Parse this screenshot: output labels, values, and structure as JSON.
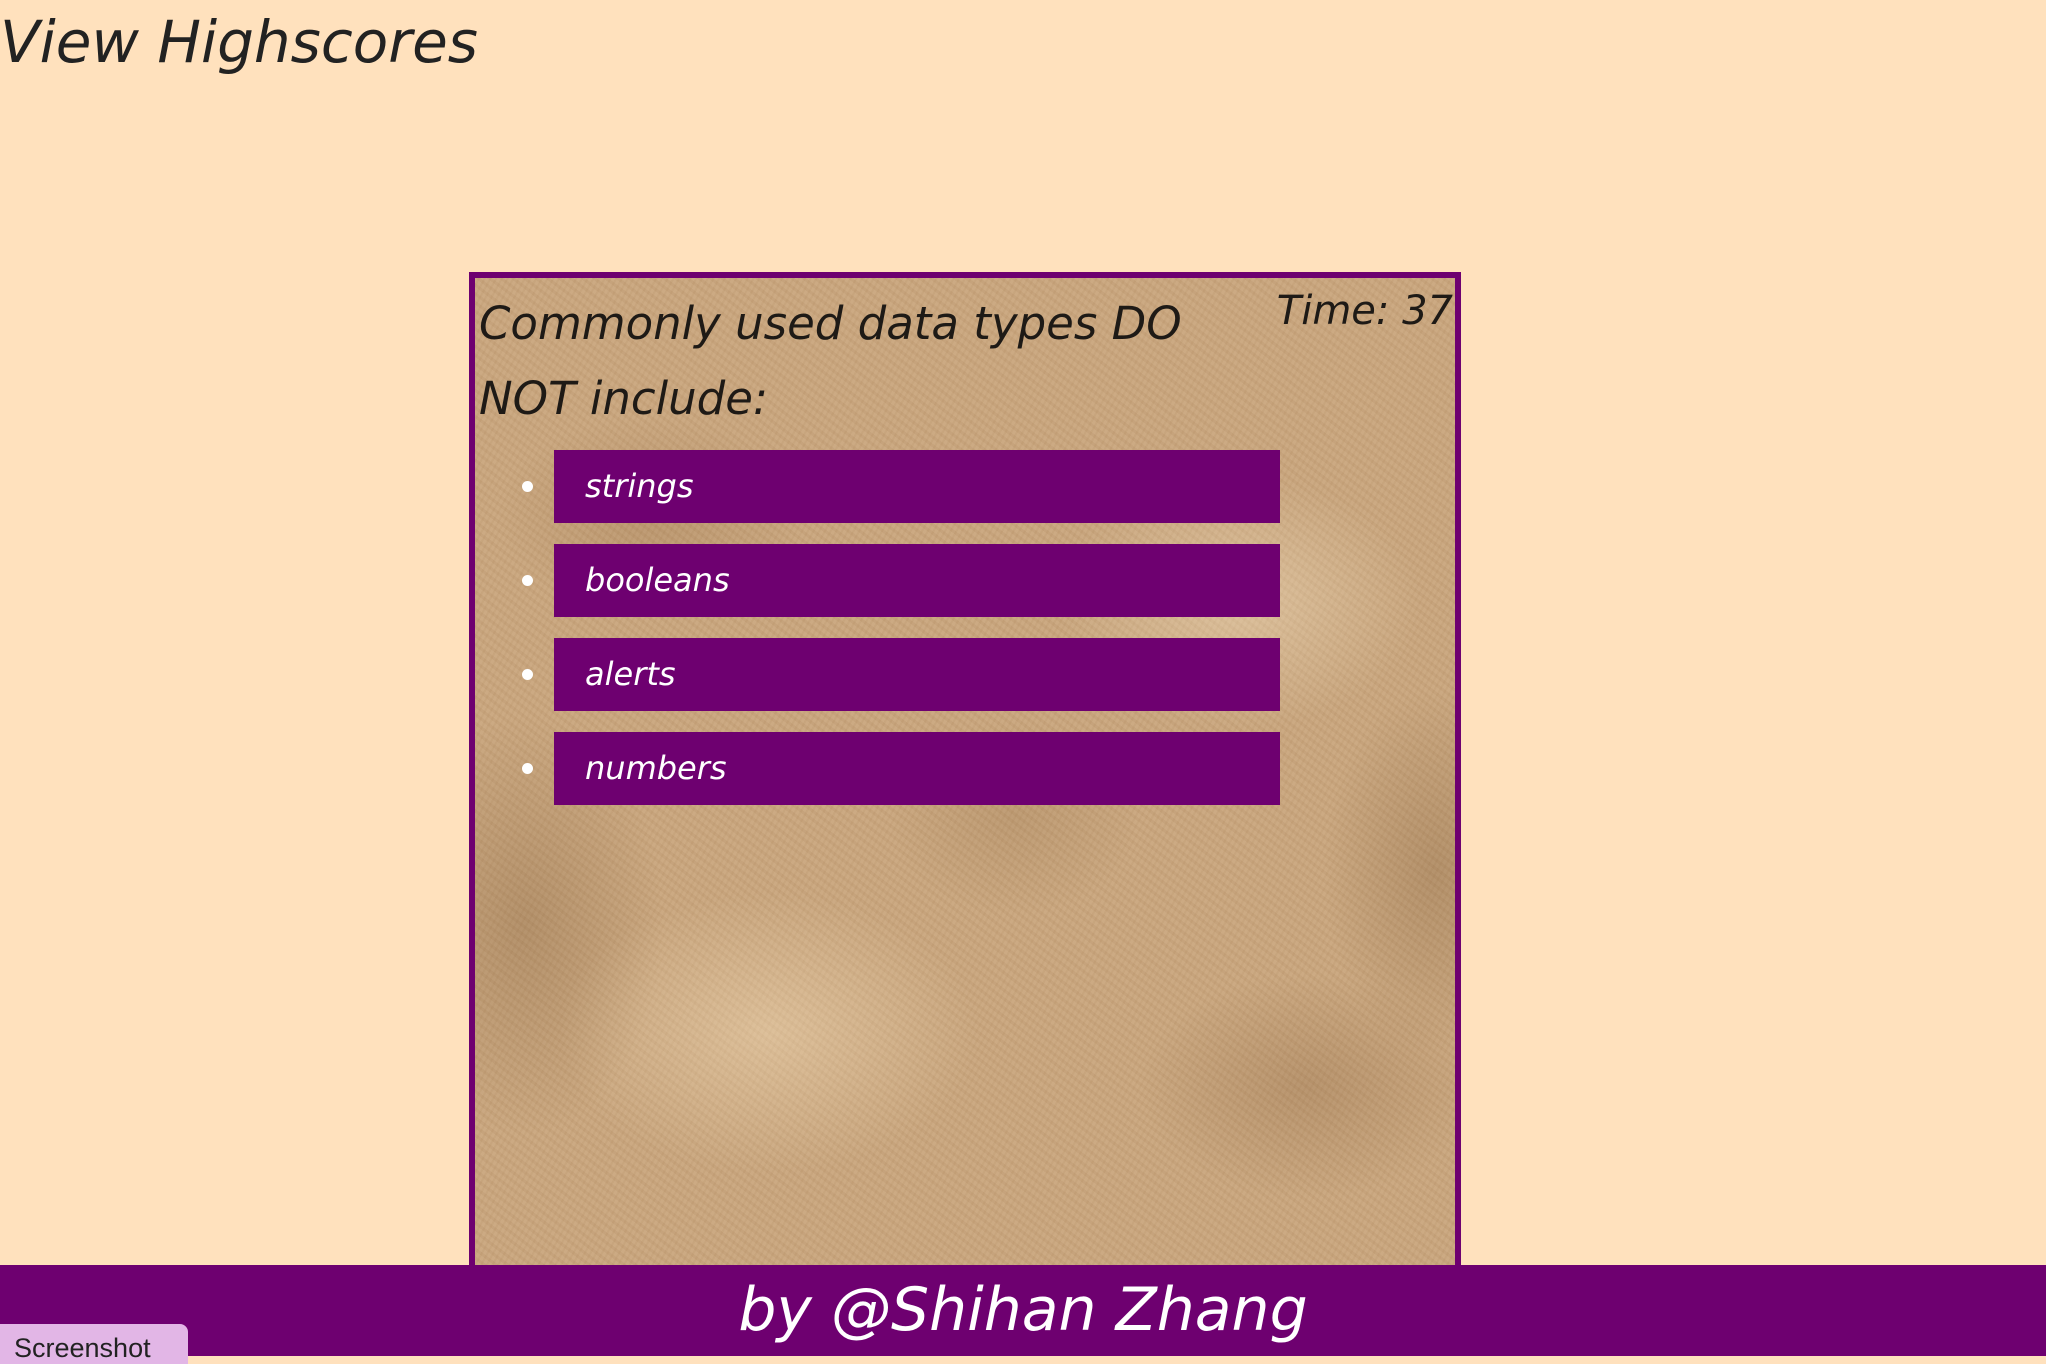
{
  "header": {
    "view_highscores_label": "View Highscores"
  },
  "quiz": {
    "question": "Commonly used data types DO NOT include:",
    "timer_label": "Time: 37",
    "answers": [
      {
        "label": "strings"
      },
      {
        "label": "booleans"
      },
      {
        "label": "alerts"
      },
      {
        "label": "numbers"
      }
    ]
  },
  "footer": {
    "credit": "by @Shihan Zhang"
  },
  "overlay": {
    "screenshot_label": "Screenshot"
  },
  "colors": {
    "page_background": "#ffe1bd",
    "accent_purple": "#6e0070",
    "answer_text": "#ffffff"
  }
}
